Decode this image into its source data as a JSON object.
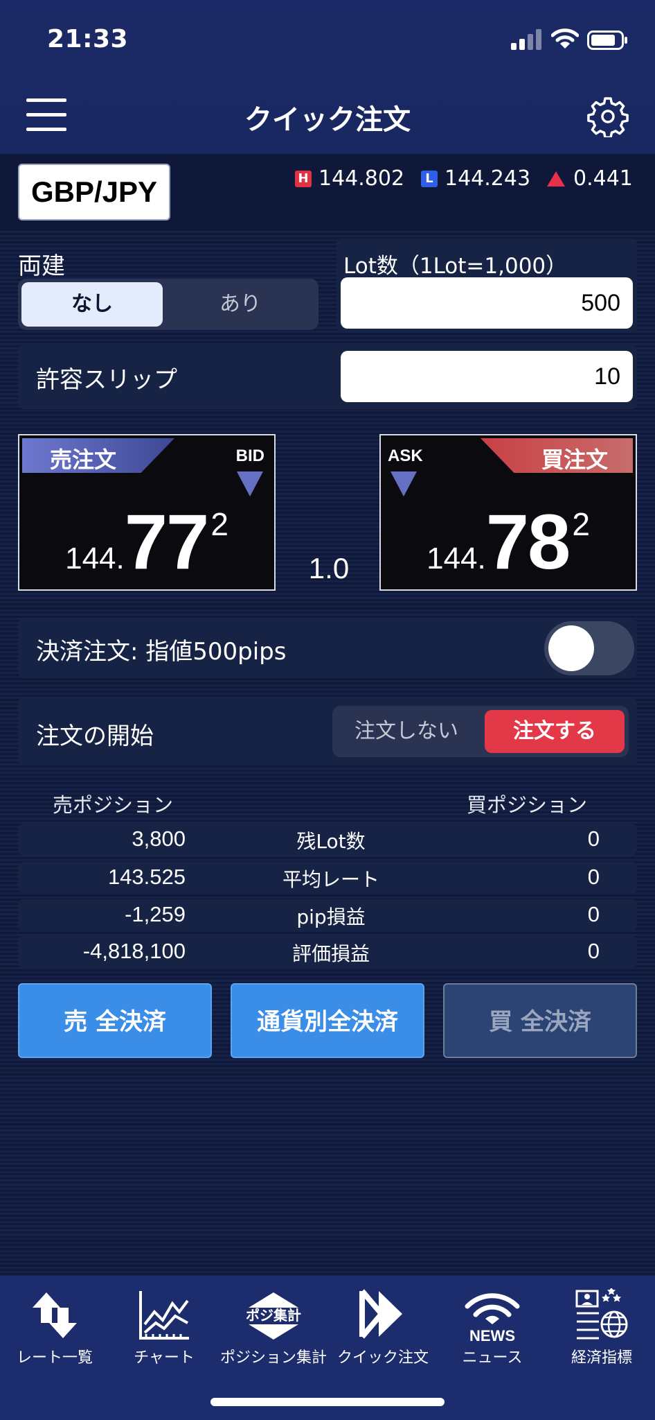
{
  "status_bar": {
    "time": "21:33"
  },
  "header": {
    "title": "クイック注文"
  },
  "pair": {
    "name": "GBP/JPY",
    "high_badge": "H",
    "high": "144.802",
    "low_badge": "L",
    "low": "144.243",
    "change": "0.441"
  },
  "hedge": {
    "label": "両建",
    "option_off": "なし",
    "option_on": "あり"
  },
  "lot": {
    "label": "Lot数（1Lot=1,000）",
    "value": "500"
  },
  "slip": {
    "label": "許容スリップ",
    "value": "10"
  },
  "sell": {
    "tab": "売注文",
    "side": "BID",
    "price_int": "144.",
    "price_big": "77",
    "price_sup": "2"
  },
  "buy": {
    "tab": "買注文",
    "side": "ASK",
    "price_int": "144.",
    "price_big": "78",
    "price_sup": "2"
  },
  "spread": "1.0",
  "settlement": {
    "label": "決済注文: 指値500pips",
    "enabled": false
  },
  "order_start": {
    "label": "注文の開始",
    "option_off": "注文しない",
    "option_on": "注文する"
  },
  "positions": {
    "sell_header": "売ポジション",
    "buy_header": "買ポジション",
    "rows": [
      {
        "sell": "3,800",
        "label": "残Lot数",
        "buy": "0"
      },
      {
        "sell": "143.525",
        "label": "平均レート",
        "buy": "0"
      },
      {
        "sell": "-1,259",
        "label": "pip損益",
        "buy": "0"
      },
      {
        "sell": "-4,818,100",
        "label": "評価損益",
        "buy": "0"
      }
    ]
  },
  "actions": {
    "sell_all": "売 全決済",
    "currency_all": "通貨別全決済",
    "buy_all": "買 全決済"
  },
  "tabs": [
    {
      "label": "レート一覧",
      "icon": "arrows-updown-icon"
    },
    {
      "label": "チャート",
      "icon": "chart-icon"
    },
    {
      "label": "ポジション集計",
      "icon": "position-summary-icon",
      "icon_text": "ポジ集計"
    },
    {
      "label": "クイック注文",
      "icon": "quick-order-icon"
    },
    {
      "label": "ニュース",
      "icon": "news-icon",
      "icon_text": "NEWS"
    },
    {
      "label": "経済指標",
      "icon": "economic-indicator-icon"
    }
  ],
  "colors": {
    "accent_red": "#e33848",
    "accent_blue": "#3b8ee8",
    "header_bg": "#1b2a66"
  }
}
